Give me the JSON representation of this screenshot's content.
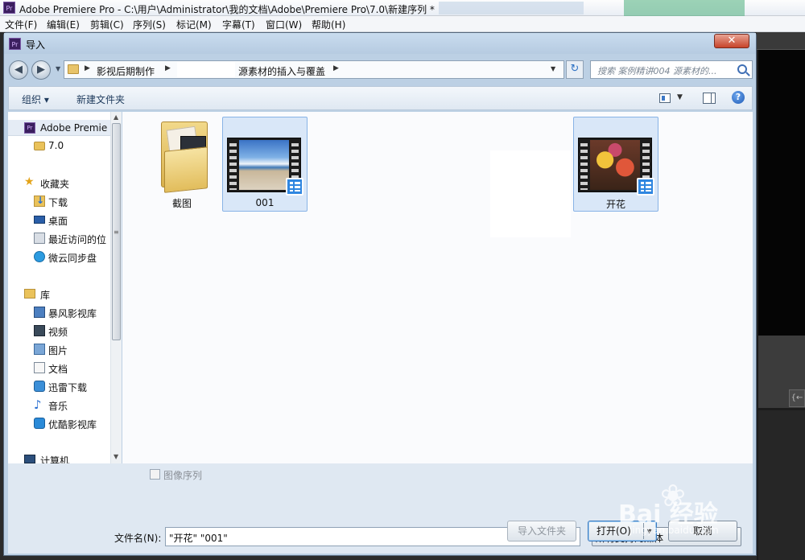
{
  "app": {
    "logo": "Pr",
    "title": "Adobe Premiere Pro - C:\\用户\\Administrator\\我的文档\\Adobe\\Premiere Pro\\7.0\\新建序列 *",
    "menus": [
      "文件(F)",
      "编辑(E)",
      "剪辑(C)",
      "序列(S)",
      "标记(M)",
      "字幕(T)",
      "窗口(W)",
      "帮助(H)"
    ]
  },
  "dialog": {
    "title": "导入",
    "close_label": "✕",
    "address": {
      "crumb1": "影视后期制作",
      "crumb2": "源素材的插入与覆盖",
      "dropdown_glyph": "▼",
      "refresh_glyph": "↻"
    },
    "search_placeholder": "搜索 案例精讲004 源素材的...",
    "toolbar": {
      "organize": "组织 ▾",
      "new_folder": "新建文件夹",
      "view_drop": "▼",
      "help": "?"
    },
    "nav": {
      "items": [
        {
          "label": "Adobe Premie",
          "icon": "premiere-icon"
        },
        {
          "label": "7.0",
          "icon": "folder-icon"
        },
        {
          "label": "收藏夹",
          "icon": "star-icon"
        },
        {
          "label": "下载",
          "icon": "download-folder-icon"
        },
        {
          "label": "桌面",
          "icon": "desktop-icon"
        },
        {
          "label": "最近访问的位",
          "icon": "recent-places-icon"
        },
        {
          "label": "微云同步盘",
          "icon": "weiyun-icon"
        },
        {
          "label": "库",
          "icon": "library-icon"
        },
        {
          "label": "暴风影视库",
          "icon": "baofeng-library-icon"
        },
        {
          "label": "视频",
          "icon": "video-library-icon"
        },
        {
          "label": "图片",
          "icon": "pictures-library-icon"
        },
        {
          "label": "文档",
          "icon": "documents-library-icon"
        },
        {
          "label": "迅雷下载",
          "icon": "thunder-icon"
        },
        {
          "label": "音乐",
          "icon": "music-icon"
        },
        {
          "label": "优酷影视库",
          "icon": "youku-library-icon"
        },
        {
          "label": "计算机",
          "icon": "computer-icon"
        }
      ],
      "scroll_up": "▲",
      "scroll_grip": "≡",
      "scroll_down": "▼"
    },
    "files": [
      {
        "name": "截图",
        "type": "folder",
        "selected": false
      },
      {
        "name": "001",
        "type": "video",
        "selected": true
      },
      {
        "name": "开花",
        "type": "video",
        "selected": true
      }
    ],
    "image_sequence_label": "图像序列",
    "filename_label": "文件名(N):",
    "filename_value": "\"开花\" \"001\"",
    "filename_drop": "▼",
    "filter_value": "所有支持的媒体",
    "buttons": {
      "import_folder": "导入文件夹",
      "open": "打开(O)",
      "open_arrow": "▼",
      "cancel": "取消"
    }
  },
  "right_panel": {
    "button_label": "{←"
  },
  "watermark": {
    "paw": "❀",
    "text": "Bai  经验",
    "url": "jingyan.baidu.com"
  }
}
